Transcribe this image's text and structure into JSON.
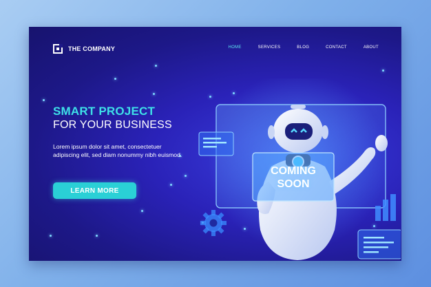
{
  "header": {
    "brand": "THE COMPANY",
    "logo_icon": "square-bracket-logo-icon",
    "nav": [
      {
        "label": "HOME",
        "active": true
      },
      {
        "label": "SERVICES",
        "active": false
      },
      {
        "label": "BLOG",
        "active": false
      },
      {
        "label": "CONTACT",
        "active": false
      },
      {
        "label": "ABOUT",
        "active": false
      }
    ]
  },
  "hero": {
    "title_line1": "SMART PROJECT",
    "title_line2": "FOR YOUR BUSINESS",
    "description": "Lorem ipsum dolor sit amet, consectetuer adipiscing elit, sed diam nonummy nibh euismod.",
    "cta_label": "LEARN MORE"
  },
  "illustration": {
    "screen_line1": "COMING",
    "screen_line2": "SOON",
    "icons": [
      "robot-icon",
      "gear-icon",
      "bar-chart-icon",
      "chat-panel-icon"
    ]
  },
  "colors": {
    "accent": "#3ee1e8",
    "button": "#2ad0d6",
    "background_dark": "#1d1888",
    "background_light": "#3a3fe0",
    "nav_active": "#5ee8f0"
  }
}
